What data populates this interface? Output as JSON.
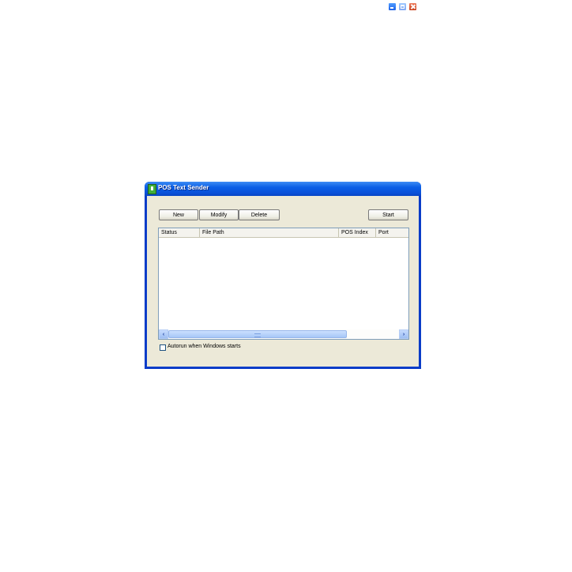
{
  "window": {
    "title": "POS Text Sender",
    "controls": [
      "minimize-icon",
      "maximize-icon",
      "close-icon"
    ]
  },
  "toolbar": {
    "new_label": "New",
    "modify_label": "Modify",
    "delete_label": "Delete",
    "start_label": "Start"
  },
  "list": {
    "columns": [
      "Status",
      "File Path",
      "POS Index",
      "Port"
    ],
    "rows": []
  },
  "scrollbar": {
    "left_glyph": "‹",
    "right_glyph": "›"
  },
  "options": {
    "autorun_label": "Autorun when Windows starts",
    "autorun_checked": false
  }
}
